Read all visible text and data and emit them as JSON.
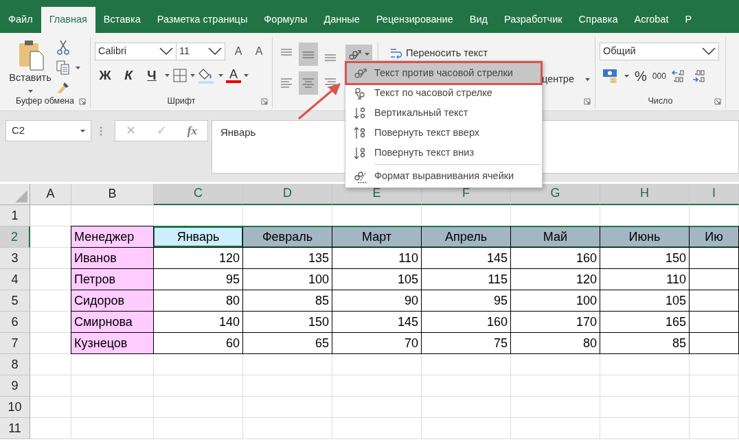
{
  "tabs": [
    {
      "label": "Файл",
      "selected": false
    },
    {
      "label": "Главная",
      "selected": true
    },
    {
      "label": "Вставка",
      "selected": false
    },
    {
      "label": "Разметка страницы",
      "selected": false
    },
    {
      "label": "Формулы",
      "selected": false
    },
    {
      "label": "Данные",
      "selected": false
    },
    {
      "label": "Рецензирование",
      "selected": false
    },
    {
      "label": "Вид",
      "selected": false
    },
    {
      "label": "Разработчик",
      "selected": false
    },
    {
      "label": "Справка",
      "selected": false
    },
    {
      "label": "Acrobat",
      "selected": false
    },
    {
      "label": "Р",
      "selected": false
    }
  ],
  "ribbon": {
    "clipboard": {
      "paste": "Вставить",
      "label": "Буфер обмена"
    },
    "font": {
      "name": "Calibri",
      "size": "11",
      "grow": "A",
      "shrink": "A",
      "bold": "Ж",
      "italic": "К",
      "underline": "Ч",
      "color_letter": "A",
      "label": "Шрифт"
    },
    "alignment": {
      "vertical": [
        {
          "selected": false
        },
        {
          "selected": true
        },
        {
          "selected": false
        }
      ],
      "horizontal": [
        {
          "selected": false
        },
        {
          "selected": true
        },
        {
          "selected": false
        }
      ],
      "orientation_selected": true,
      "wrap": "Переносить текст",
      "merge": "центре"
    },
    "number": {
      "format": "Общий",
      "percent": "%",
      "thousands": "000",
      "label": "Число"
    }
  },
  "orientation_menu": {
    "items": [
      {
        "label": "Текст против часовой стрелки",
        "selected": true,
        "separated": false
      },
      {
        "label": "Текст по часовой стрелке",
        "selected": false,
        "separated": false
      },
      {
        "label": "Вертикальный текст",
        "selected": false,
        "separated": false
      },
      {
        "label": "Повернуть текст вверх",
        "selected": false,
        "separated": false
      },
      {
        "label": "Повернуть текст вниз",
        "selected": false,
        "separated": false
      },
      {
        "label": "Формат выравнивания ячейки",
        "selected": false,
        "separated": true
      }
    ]
  },
  "callout": {
    "box": true,
    "arrow": true
  },
  "formula_bar": {
    "name_box": "C2",
    "cancel": "✕",
    "enter": "✓",
    "fx": "fx",
    "value": "Январь"
  },
  "sheet": {
    "columns": [
      {
        "label": "A",
        "selected": false
      },
      {
        "label": "B",
        "selected": false
      },
      {
        "label": "C",
        "selected": true
      },
      {
        "label": "D",
        "selected": true
      },
      {
        "label": "E",
        "selected": true
      },
      {
        "label": "F",
        "selected": true
      },
      {
        "label": "G",
        "selected": true
      },
      {
        "label": "H",
        "selected": true
      },
      {
        "label": "I",
        "selected": true
      }
    ],
    "rows": [
      {
        "label": "1",
        "selected": false
      },
      {
        "label": "2",
        "selected": true,
        "cells": [
          {
            "text": "Менеджер",
            "kind": "label",
            "selected": false,
            "active": false
          },
          {
            "text": "Январь",
            "kind": "month",
            "selected": true,
            "active": true
          },
          {
            "text": "Февраль",
            "kind": "month",
            "selected": true,
            "active": false
          },
          {
            "text": "Март",
            "kind": "month",
            "selected": true,
            "active": false
          },
          {
            "text": "Апрель",
            "kind": "month",
            "selected": true,
            "active": false
          },
          {
            "text": "Май",
            "kind": "month",
            "selected": true,
            "active": false
          },
          {
            "text": "Июнь",
            "kind": "month",
            "selected": true,
            "active": false
          },
          {
            "text": "Ию",
            "kind": "month",
            "selected": true,
            "active": false
          }
        ]
      },
      {
        "label": "3",
        "selected": false,
        "cells": [
          {
            "text": "Иванов",
            "kind": "label",
            "selected": false,
            "active": false
          },
          {
            "text": "120",
            "kind": "number",
            "selected": false,
            "active": false
          },
          {
            "text": "135",
            "kind": "number",
            "selected": false,
            "active": false
          },
          {
            "text": "110",
            "kind": "number",
            "selected": false,
            "active": false
          },
          {
            "text": "145",
            "kind": "number",
            "selected": false,
            "active": false
          },
          {
            "text": "160",
            "kind": "number",
            "selected": false,
            "active": false
          },
          {
            "text": "150",
            "kind": "number",
            "selected": false,
            "active": false
          }
        ]
      },
      {
        "label": "4",
        "selected": false,
        "cells": [
          {
            "text": "Петров",
            "kind": "label",
            "selected": false,
            "active": false
          },
          {
            "text": "95",
            "kind": "number",
            "selected": false,
            "active": false
          },
          {
            "text": "100",
            "kind": "number",
            "selected": false,
            "active": false
          },
          {
            "text": "105",
            "kind": "number",
            "selected": false,
            "active": false
          },
          {
            "text": "115",
            "kind": "number",
            "selected": false,
            "active": false
          },
          {
            "text": "120",
            "kind": "number",
            "selected": false,
            "active": false
          },
          {
            "text": "110",
            "kind": "number",
            "selected": false,
            "active": false
          }
        ]
      },
      {
        "label": "5",
        "selected": false,
        "cells": [
          {
            "text": "Сидоров",
            "kind": "label",
            "selected": false,
            "active": false
          },
          {
            "text": "80",
            "kind": "number",
            "selected": false,
            "active": false
          },
          {
            "text": "85",
            "kind": "number",
            "selected": false,
            "active": false
          },
          {
            "text": "90",
            "kind": "number",
            "selected": false,
            "active": false
          },
          {
            "text": "95",
            "kind": "number",
            "selected": false,
            "active": false
          },
          {
            "text": "100",
            "kind": "number",
            "selected": false,
            "active": false
          },
          {
            "text": "105",
            "kind": "number",
            "selected": false,
            "active": false
          }
        ]
      },
      {
        "label": "6",
        "selected": false,
        "cells": [
          {
            "text": "Смирнова",
            "kind": "label",
            "selected": false,
            "active": false
          },
          {
            "text": "140",
            "kind": "number",
            "selected": false,
            "active": false
          },
          {
            "text": "150",
            "kind": "number",
            "selected": false,
            "active": false
          },
          {
            "text": "145",
            "kind": "number",
            "selected": false,
            "active": false
          },
          {
            "text": "160",
            "kind": "number",
            "selected": false,
            "active": false
          },
          {
            "text": "170",
            "kind": "number",
            "selected": false,
            "active": false
          },
          {
            "text": "165",
            "kind": "number",
            "selected": false,
            "active": false
          }
        ]
      },
      {
        "label": "7",
        "selected": false,
        "cells": [
          {
            "text": "Кузнецов",
            "kind": "label",
            "selected": false,
            "active": false
          },
          {
            "text": "60",
            "kind": "number",
            "selected": false,
            "active": false
          },
          {
            "text": "65",
            "kind": "number",
            "selected": false,
            "active": false
          },
          {
            "text": "70",
            "kind": "number",
            "selected": false,
            "active": false
          },
          {
            "text": "75",
            "kind": "number",
            "selected": false,
            "active": false
          },
          {
            "text": "80",
            "kind": "number",
            "selected": false,
            "active": false
          },
          {
            "text": "85",
            "kind": "number",
            "selected": false,
            "active": false
          }
        ]
      },
      {
        "label": "8",
        "selected": false
      },
      {
        "label": "9",
        "selected": false
      },
      {
        "label": "10",
        "selected": false
      },
      {
        "label": "11",
        "selected": false
      }
    ]
  }
}
